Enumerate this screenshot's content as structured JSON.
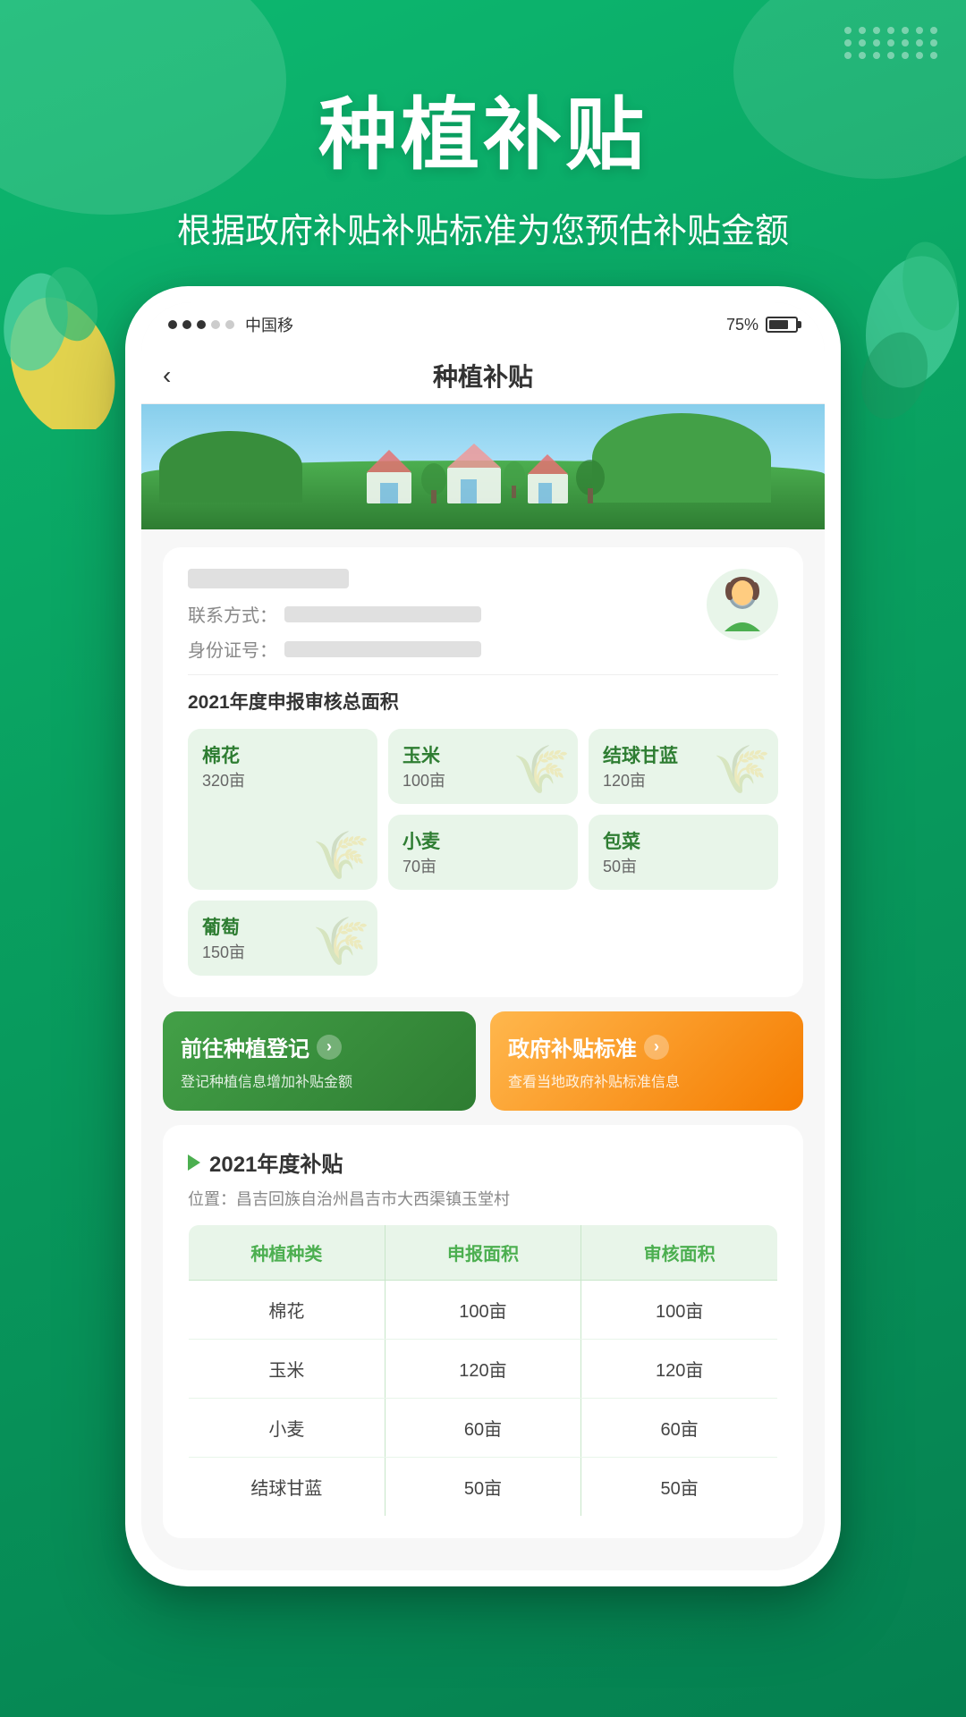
{
  "app": {
    "title": "种植补贴",
    "subtitle": "根据政府补贴补贴标准为您预估补贴金额"
  },
  "status_bar": {
    "carrier": "中国移",
    "battery": "75%"
  },
  "nav": {
    "back": "‹",
    "title": "种植补贴"
  },
  "user": {
    "name_label": "",
    "contact_label": "联系方式：",
    "id_label": "身份证号："
  },
  "crops_section": {
    "title": "2021年度申报审核总面积",
    "crops": [
      {
        "name": "棉花",
        "area": "320亩",
        "large": true
      },
      {
        "name": "玉米",
        "area": "100亩",
        "large": false
      },
      {
        "name": "结球甘蓝",
        "area": "120亩",
        "large": false
      },
      {
        "name": "小麦",
        "area": "70亩",
        "large": false
      },
      {
        "name": "包菜",
        "area": "50亩",
        "large": false
      },
      {
        "name": "葡萄",
        "area": "150亩",
        "large": false
      }
    ]
  },
  "actions": {
    "register": {
      "title": "前往种植登记",
      "subtitle": "登记种植信息增加补贴金额",
      "arrow": "›"
    },
    "standard": {
      "title": "政府补贴标准",
      "subtitle": "查看当地政府补贴标准信息",
      "arrow": "›"
    }
  },
  "subsidy": {
    "title": "2021年度补贴",
    "location_prefix": "位置：",
    "location": "昌吉回族自治州昌吉市大西渠镇玉堂村",
    "table": {
      "headers": [
        "种植种类",
        "申报面积",
        "审核面积"
      ],
      "rows": [
        [
          "棉花",
          "100亩",
          "100亩"
        ],
        [
          "玉米",
          "120亩",
          "120亩"
        ],
        [
          "小麦",
          "60亩",
          "60亩"
        ],
        [
          "结球甘蓝",
          "50亩",
          "50亩"
        ]
      ]
    }
  },
  "dots": [
    1,
    2,
    3,
    4,
    5,
    6,
    7,
    8,
    9,
    10,
    11,
    12,
    13,
    14,
    15,
    16,
    17,
    18,
    19,
    20,
    21
  ]
}
